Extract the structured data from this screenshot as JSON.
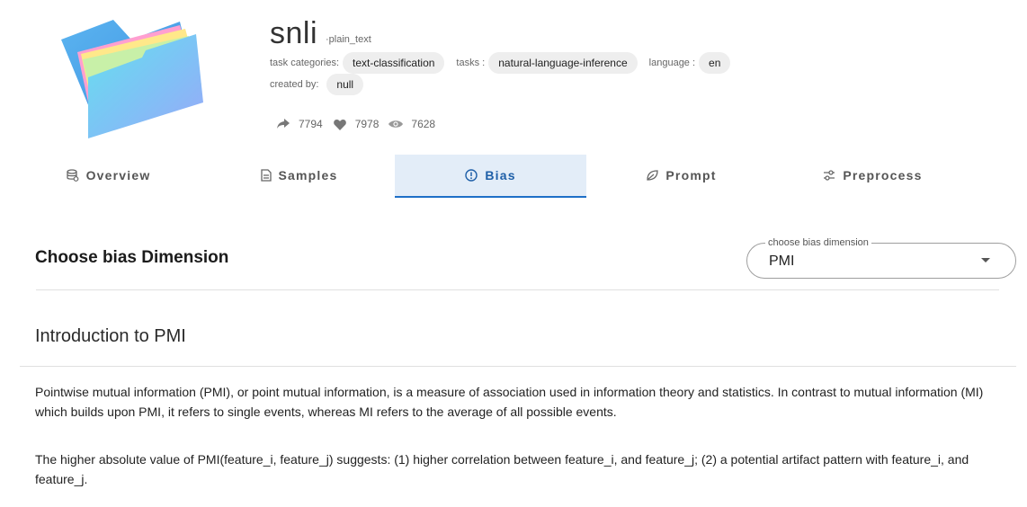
{
  "header": {
    "name": "snli",
    "format": "·plain_text",
    "task_categories_label": "task categories:",
    "task_category": "text-classification",
    "tasks_label": "tasks :",
    "task": "natural-language-inference",
    "language_label": "language :",
    "language": "en",
    "created_by_label": "created by:",
    "created_by": "null",
    "stats": {
      "shares": "7794",
      "likes": "7978",
      "views": "7628"
    },
    "icons": [
      "folder-icon",
      "share-icon",
      "heart-icon",
      "eye-icon"
    ]
  },
  "tabs": [
    {
      "label": "Overview",
      "icon": "database-icon"
    },
    {
      "label": "Samples",
      "icon": "document-icon"
    },
    {
      "label": "Bias",
      "icon": "alert-circle-icon",
      "active": true
    },
    {
      "label": "Prompt",
      "icon": "leaf-icon"
    },
    {
      "label": "Preprocess",
      "icon": "sliders-icon"
    }
  ],
  "bias": {
    "title": "Choose bias Dimension",
    "select_label": "choose bias dimension",
    "select_value": "PMI"
  },
  "intro": {
    "heading": "Introduction to PMI",
    "para1": "Pointwise mutual information (PMI), or point mutual information, is a measure of association used in information theory and statistics. In contrast to mutual information (MI) which builds upon PMI, it refers to single events, whereas MI refers to the average of all possible events.",
    "para2": "The higher absolute value of PMI(feature_i, feature_j) suggests: (1) higher correlation between feature_i, and feature_j; (2) a potential artifact pattern with feature_i, and feature_j."
  },
  "colors": {
    "tab_active_bg": "#e3edf8",
    "tab_active_text": "#1e5fa8",
    "chip_bg": "#eeeeee"
  }
}
